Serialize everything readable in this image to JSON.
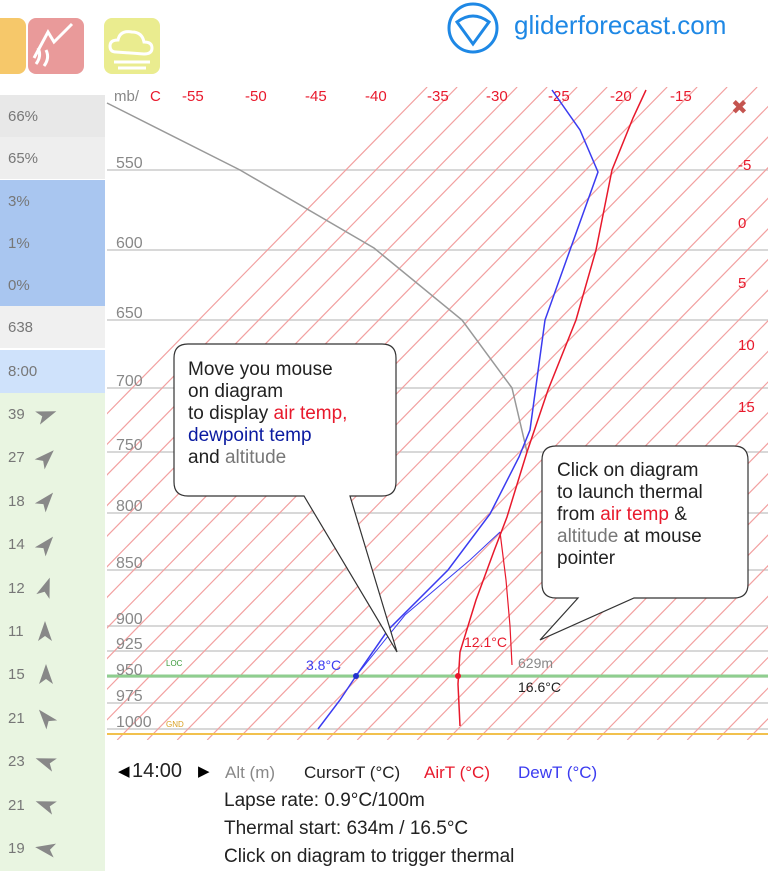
{
  "header": {
    "brand": "gliderforecast.com",
    "buttons": [
      "cloud-base-button",
      "thermal-button",
      "cloud-button"
    ]
  },
  "sidebar": {
    "rows": [
      {
        "value": "66%",
        "bg": "#e8e8e8"
      },
      {
        "value": "65%",
        "bg": "#eeeeee"
      },
      {
        "value": "3%",
        "bg": "#a9c6f0"
      },
      {
        "value": "1%",
        "bg": "#a9c6f0"
      },
      {
        "value": "0%",
        "bg": "#a9c6f0"
      },
      {
        "value": "638",
        "bg": "#f0f0f0"
      },
      {
        "value": "8:00",
        "bg": "#cfe2fb"
      }
    ],
    "wind_speeds": [
      "39",
      "27",
      "18",
      "14",
      "12",
      "11",
      "15",
      "21",
      "23",
      "21",
      "19"
    ]
  },
  "diagram": {
    "axis_unit_label": "mb/",
    "axis_unit_c": "C",
    "top_temp_labels": [
      "-55",
      "-50",
      "-45",
      "-40",
      "-35",
      "-30",
      "-25",
      "-20",
      "-15"
    ],
    "right_temp_labels": [
      "-5",
      "0",
      "5",
      "10",
      "15"
    ],
    "pressure_labels": [
      "550",
      "600",
      "650",
      "700",
      "750",
      "800",
      "850",
      "900",
      "925",
      "950",
      "975",
      "1000"
    ],
    "loc_label": "LOC",
    "gnd_label": "GND",
    "dew_readout": "3.8°C",
    "air_readout": "12.1°C",
    "alt_readout": "629m",
    "cursor_readout": "16.6°C",
    "close_symbol": "✖"
  },
  "bubbles": {
    "left": {
      "line1": "Move you mouse",
      "line2": "on diagram",
      "line3_prefix": "to display ",
      "line3_red": "air temp,",
      "line4_blue": "dewpoint temp",
      "line5_prefix": "and ",
      "line5_grey": "altitude"
    },
    "right": {
      "line1": "Click on diagram",
      "line2": "to launch thermal",
      "line3_prefix": "from ",
      "line3_red": "air temp",
      "line3_suffix": " &",
      "line4_grey": "altitude",
      "line4_suffix": " at mouse",
      "line5": "pointer"
    }
  },
  "controls": {
    "prev": "◀",
    "time": "14:00",
    "next": "▶",
    "legend_alt": "Alt (m)",
    "legend_cursor": "CursorT (°C)",
    "legend_air": "AirT (°C)",
    "legend_dew": "DewT (°C)"
  },
  "info": {
    "lapse": "Lapse rate: 0.9°C/100m",
    "thermal": "Thermal start: 634m / 16.5°C",
    "hint": "Click on diagram to trigger thermal"
  },
  "colors": {
    "air": "#e8192c",
    "dew": "#3b3bf0",
    "altitude": "#999999",
    "isotherm": "#f2a0a0",
    "loc_line": "#8fce8f",
    "gnd_line": "#f2c14e",
    "brand": "#1e88e5"
  }
}
